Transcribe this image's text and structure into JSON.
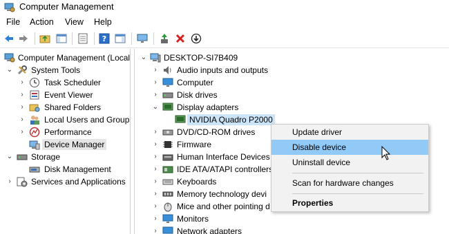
{
  "window": {
    "title": "Computer Management"
  },
  "menu": [
    "File",
    "Action",
    "View",
    "Help"
  ],
  "left_tree": {
    "root": "Computer Management (Local",
    "system_tools": "System Tools",
    "task_scheduler": "Task Scheduler",
    "event_viewer": "Event Viewer",
    "shared_folders": "Shared Folders",
    "local_users": "Local Users and Groups",
    "performance": "Performance",
    "device_manager": "Device Manager",
    "storage": "Storage",
    "disk_management": "Disk Management",
    "services": "Services and Applications"
  },
  "right_tree": {
    "computer": "DESKTOP-SI7B409",
    "audio": "Audio inputs and outputs",
    "computer_node": "Computer",
    "disk_drives": "Disk drives",
    "display_adapters": "Display adapters",
    "nvidia": "NVIDIA Quadro P2000",
    "dvd": "DVD/CD-ROM drives",
    "firmware": "Firmware",
    "hid": "Human Interface Devices",
    "ide": "IDE ATA/ATAPI controllers",
    "keyboards": "Keyboards",
    "memory": "Memory technology devi",
    "mice": "Mice and other pointing d",
    "monitors": "Monitors",
    "network": "Network adapters"
  },
  "context_menu": {
    "update": "Update driver",
    "disable": "Disable device",
    "uninstall": "Uninstall device",
    "scan": "Scan for hardware changes",
    "properties": "Properties"
  }
}
